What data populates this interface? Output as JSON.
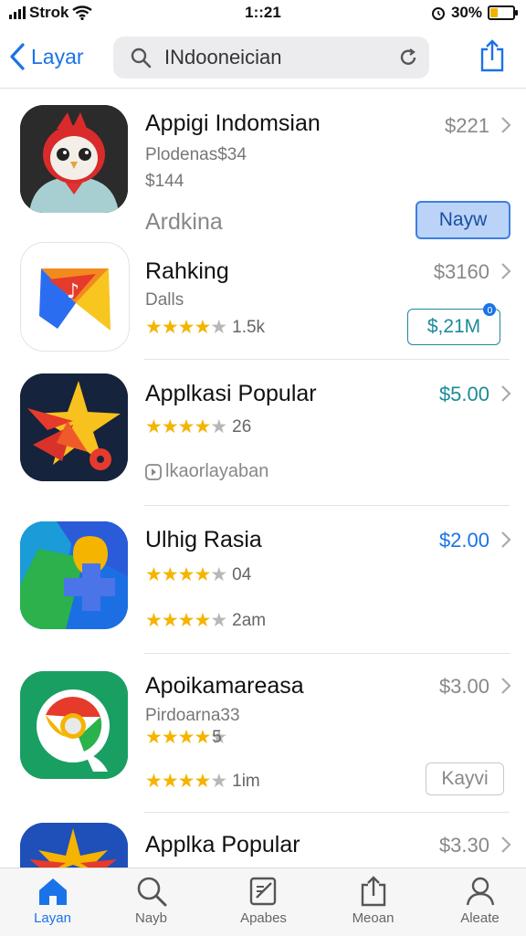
{
  "status_bar": {
    "carrier": "Strok",
    "time": "1::21",
    "battery": "30%"
  },
  "nav": {
    "back_label": "Layar",
    "search_value": "INdooneician"
  },
  "apps": [
    {
      "title": "Appigi Indomsian",
      "subtitle": "Plodenas$34",
      "subtitle2": "$144",
      "extra": "Ardkina",
      "price": "$221",
      "button": "Nayw"
    },
    {
      "title": "Rahking",
      "subtitle": "Dalls",
      "rating_count": "1.5k",
      "price": "$3160",
      "button": "$,21M"
    },
    {
      "title": "Applkasi Popular",
      "rating_count": "26",
      "extra": "lkaorlayaban",
      "price": "$5.00"
    },
    {
      "title": "Ulhig Rasia",
      "rating_count": "04",
      "rating_count2": "2am",
      "price": "$2.00"
    },
    {
      "title": "Apoikamareasa",
      "subtitle": "Pirdoarna33",
      "rating_count": "5",
      "rating_count2": "1im",
      "price": "$3.00",
      "button": "Kayvi"
    },
    {
      "title": "Applka Popular",
      "price": "$3.30"
    }
  ],
  "tabs": [
    {
      "label": "Layan",
      "icon": "home-icon"
    },
    {
      "label": "Nayb",
      "icon": "search-icon"
    },
    {
      "label": "Apabes",
      "icon": "apps-icon"
    },
    {
      "label": "Meoan",
      "icon": "updates-icon"
    },
    {
      "label": "Aleate",
      "icon": "profile-icon"
    }
  ],
  "colors": {
    "accent": "#1a73e8",
    "teal": "#1a8a9a",
    "star": "#f4b400"
  }
}
